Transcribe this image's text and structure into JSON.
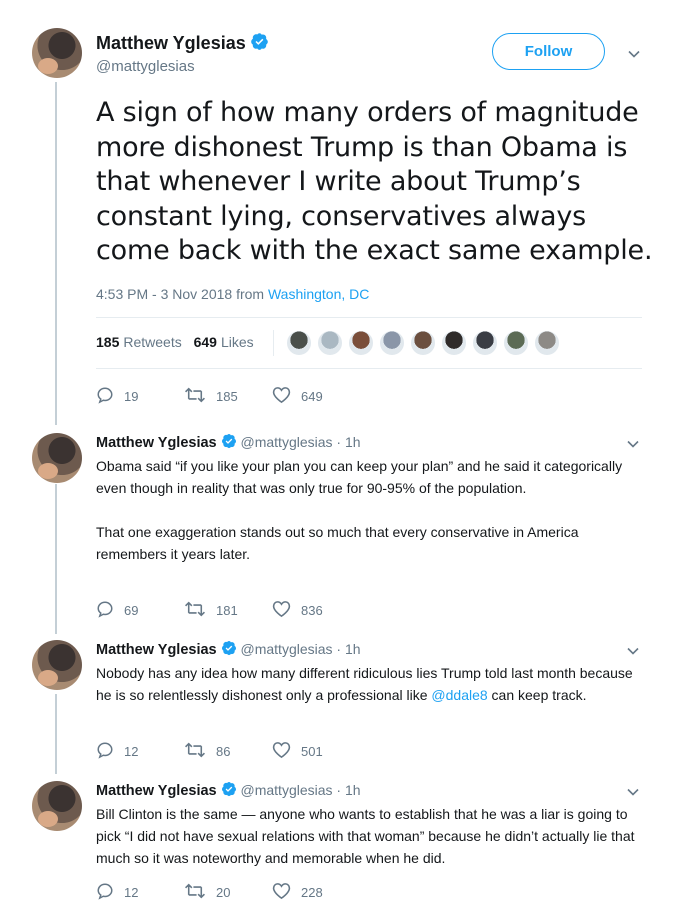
{
  "main_tweet": {
    "author_name": "Matthew Yglesias",
    "handle": "@mattyglesias",
    "follow_label": "Follow",
    "text": "A sign of how many orders of magnitude more dishonest Trump is than Obama is that whenever I write about Trump’s constant lying, conservatives always come back with the exact same example.",
    "timestamp": "4:53 PM - 3 Nov 2018 from ",
    "location": "Washington, DC",
    "retweets_count": "185",
    "retweets_label": "Retweets",
    "likes_count": "649",
    "likes_label": "Likes",
    "actions": {
      "replies": "19",
      "retweets": "185",
      "likes": "649"
    },
    "liker_colors": [
      "#4a4f4a",
      "#aab8c2",
      "#7a4e3a",
      "#8a96a8",
      "#6b4f3f",
      "#2f2b2a",
      "#3a3d44",
      "#5c6b55",
      "#8d8a86"
    ]
  },
  "replies": [
    {
      "author_name": "Matthew Yglesias",
      "handle": "@mattyglesias",
      "time": "· 1h",
      "paragraphs": [
        "Obama said “if you like your plan you can keep your plan” and he said it categorically even though in reality that was only true for 90-95% of the population.",
        "That one exaggeration stands out so much that every conservative in America remembers it years later."
      ],
      "actions": {
        "replies": "69",
        "retweets": "181",
        "likes": "836"
      }
    },
    {
      "author_name": "Matthew Yglesias",
      "handle": "@mattyglesias",
      "time": "· 1h",
      "text_before": "Nobody has any idea how many different ridiculous lies Trump told last month because he is so relentlessly dishonest only a professional like ",
      "mention": "@ddale8",
      "text_after": " can keep track.",
      "actions": {
        "replies": "12",
        "retweets": "86",
        "likes": "501"
      }
    },
    {
      "author_name": "Matthew Yglesias",
      "handle": "@mattyglesias",
      "time": "· 1h",
      "paragraphs": [
        "Bill Clinton is the same — anyone who wants to establish that he was a liar is going to pick “I did not have sexual relations with that woman” because he didn’t actually lie that much so it was noteworthy and memorable when he did."
      ],
      "actions": {
        "replies": "12",
        "retweets": "20",
        "likes": "228"
      }
    }
  ],
  "colors": {
    "accent": "#1da1f2",
    "text": "#14171a",
    "muted": "#657786",
    "thread_line": "#c4cfd6"
  }
}
